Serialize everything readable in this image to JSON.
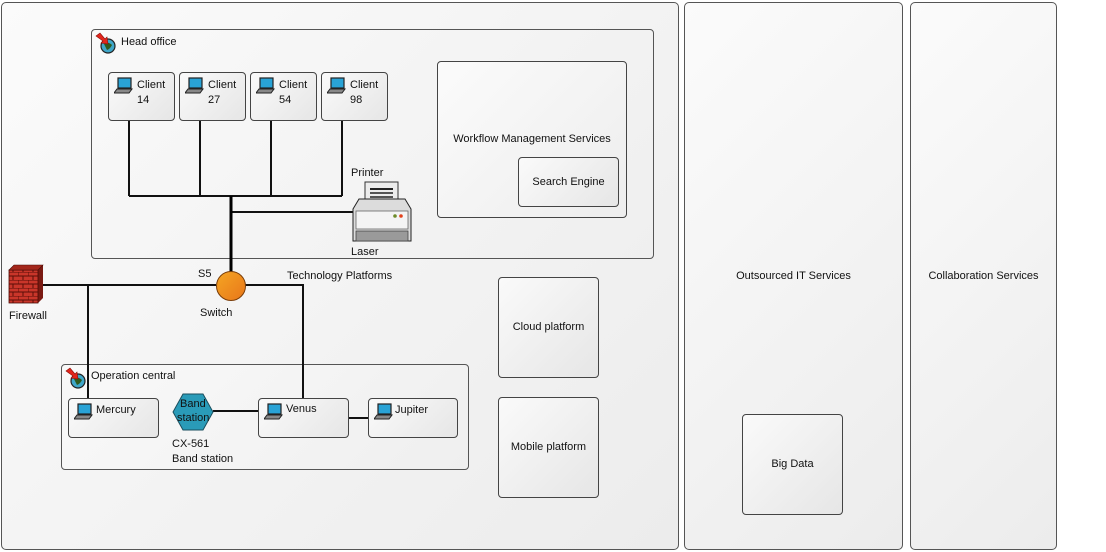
{
  "pools": {
    "main": {
      "label": ""
    },
    "outsourced": {
      "label": "Outsourced IT Services"
    },
    "collaboration": {
      "label": "Collaboration Services"
    }
  },
  "head_office": {
    "title": "Head office",
    "clients": [
      {
        "line1": "Client",
        "line2": "14"
      },
      {
        "line1": "Client",
        "line2": "27"
      },
      {
        "line1": "Client",
        "line2": "54"
      },
      {
        "line1": "Client",
        "line2": "98"
      }
    ],
    "printer": {
      "top_label": "Printer",
      "bottom_label": "Laser"
    },
    "workflow": {
      "label": "Workflow Management Services",
      "child": "Search Engine"
    }
  },
  "network": {
    "firewall": {
      "label": "Firewall"
    },
    "switch": {
      "id": "S5",
      "label": "Switch",
      "color": "#f08a1c"
    },
    "tech_platforms": {
      "label": "Technology Platforms"
    }
  },
  "operation_central": {
    "title": "Operation central",
    "nodes": [
      {
        "label": "Mercury"
      },
      {
        "label": "Venus"
      },
      {
        "label": "Jupiter"
      }
    ],
    "band_station": {
      "shape_text_1": "Band",
      "shape_text_2": "station",
      "id": "CX-561",
      "caption": "Band station",
      "color": "#2a9bb8"
    }
  },
  "platforms": {
    "cloud": "Cloud platform",
    "mobile": "Mobile platform"
  },
  "big_data": {
    "label": "Big Data"
  }
}
